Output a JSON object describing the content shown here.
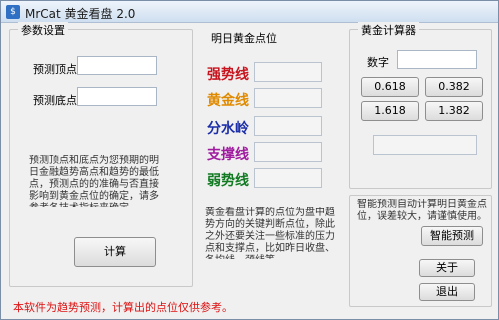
{
  "window": {
    "title": "MrCat 黄金看盘 2.0",
    "icon": "app-icon"
  },
  "params": {
    "group_title": "参数设置",
    "top_label": "预测顶点",
    "bottom_label": "预测底点",
    "top_value": "",
    "bottom_value": "",
    "description": "预测顶点和底点为您预期的明日金融趋势高点和趋势的最低点，预测点的的准确与否直接影响到黄金点位的确定，请多参考各技术指标来确定。",
    "calc_button": "计算"
  },
  "levels": {
    "group_title": "明日黄金点位",
    "items": [
      {
        "label": "强势线",
        "color": "#c8141e",
        "value": ""
      },
      {
        "label": "黄金线",
        "color": "#e08a00",
        "value": ""
      },
      {
        "label": "分水岭",
        "color": "#1c2fa8",
        "value": ""
      },
      {
        "label": "支撑线",
        "color": "#a01ba0",
        "value": ""
      },
      {
        "label": "弱势线",
        "color": "#117a22",
        "value": ""
      }
    ],
    "description": "黄金看盘计算的点位为盘中趋势方向的关键判断点位，除此之外还要关注一些标准的压力点和支撑点，比如昨日收盘、各均线、颈线等。"
  },
  "calculator": {
    "group_title": "黄金计算器",
    "number_label": "数字",
    "number_value": "",
    "ratios": [
      "0.618",
      "0.382",
      "1.618",
      "1.382"
    ],
    "result": ""
  },
  "smart": {
    "description": "智能预测自动计算明日黄金点位，误差较大，请谨慎使用。",
    "smart_button": "智能预测",
    "about_button": "关于",
    "exit_button": "退出"
  },
  "footer": {
    "note": "本软件为趋势预测，计算出的点位仅供参考。"
  }
}
